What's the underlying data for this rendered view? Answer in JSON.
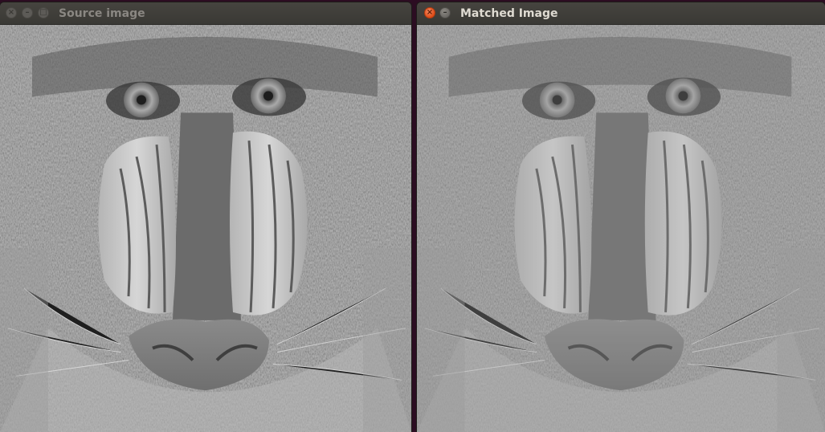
{
  "windows": [
    {
      "title": "Source image",
      "active": false,
      "buttons": {
        "close": "close-icon",
        "minimize": "minimize-icon",
        "maximize": "maximize-icon"
      }
    },
    {
      "title": "Matched Image",
      "active": true,
      "buttons": {
        "close": "close-icon",
        "minimize": "minimize-icon"
      }
    }
  ],
  "colors": {
    "desktop_background": "#2c0d22",
    "titlebar": "#3a3935",
    "close_active": "#df4b16"
  }
}
